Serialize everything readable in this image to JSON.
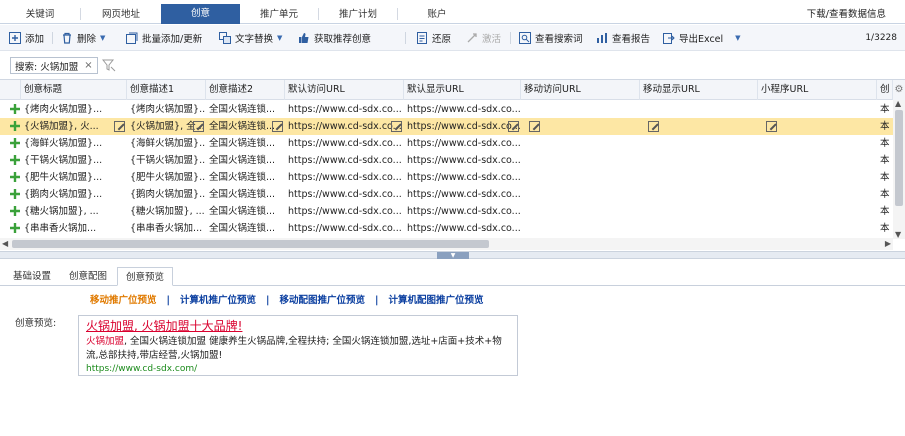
{
  "top_tabs": [
    "关键词",
    "网页地址",
    "创意",
    "推广单元",
    "推广计划",
    "账户"
  ],
  "top_right": "下载/查看数据信息",
  "toolbar": {
    "add": "添加",
    "delete": "删除",
    "batch": "批量添加/更新",
    "replace": "文字替换",
    "recommend": "获取推荐创意",
    "restore": "还原",
    "activate": "激活",
    "search_terms": "查看搜索词",
    "report": "查看报告",
    "export": "导出Excel",
    "counter": "1/3228"
  },
  "search": {
    "label": "搜索: 火锅加盟",
    "close": "×"
  },
  "grid": {
    "columns": [
      "创意标题",
      "创意描述1",
      "创意描述2",
      "默认访问URL",
      "默认显示URL",
      "移动访问URL",
      "移动显示URL",
      "小程序URL",
      "创"
    ],
    "rows": [
      [
        "{烤肉火锅加盟}...",
        "{烤肉火锅加盟}...",
        "全国火锅连锁...",
        "https://www.cd-sdx.co...",
        "https://www.cd-sdx.co...",
        "",
        "",
        "",
        "本"
      ],
      [
        "{火锅加盟}, 火...",
        "{火锅加盟}, 全...",
        "全国火锅连锁...",
        "https://www.cd-sdx.co...",
        "https://www.cd-sdx.co...",
        "",
        "",
        "",
        "本"
      ],
      [
        "{海鲜火锅加盟}...",
        "{海鲜火锅加盟}...",
        "全国火锅连锁...",
        "https://www.cd-sdx.co...",
        "https://www.cd-sdx.co...",
        "",
        "",
        "",
        "本"
      ],
      [
        "{干锅火锅加盟}...",
        "{干锅火锅加盟}...",
        "全国火锅连锁...",
        "https://www.cd-sdx.co...",
        "https://www.cd-sdx.co...",
        "",
        "",
        "",
        "本"
      ],
      [
        "{肥牛火锅加盟}...",
        "{肥牛火锅加盟}...",
        "全国火锅连锁...",
        "https://www.cd-sdx.co...",
        "https://www.cd-sdx.co...",
        "",
        "",
        "",
        "本"
      ],
      [
        "{鹅肉火锅加盟}...",
        "{鹅肉火锅加盟}...",
        "全国火锅连锁...",
        "https://www.cd-sdx.co...",
        "https://www.cd-sdx.co...",
        "",
        "",
        "",
        "本"
      ],
      [
        "{糖火锅加盟}, ...",
        "{糖火锅加盟}, ...",
        "全国火锅连锁...",
        "https://www.cd-sdx.co...",
        "https://www.cd-sdx.co...",
        "",
        "",
        "",
        "本"
      ],
      [
        "{串串香火锅加...",
        "{串串香火锅加...",
        "全国火锅连锁...",
        "https://www.cd-sdx.co...",
        "https://www.cd-sdx.co...",
        "",
        "",
        "",
        "本"
      ]
    ]
  },
  "bottom_tabs": [
    "基础设置",
    "创意配图",
    "创意预览"
  ],
  "preview": {
    "links": [
      "移动推广位预览",
      "计算机推广位预览",
      "移动配图推广位预览",
      "计算机配图推广位预览"
    ],
    "link_sep": "|",
    "label": "创意预览:",
    "title": "火锅加盟, 火锅加盟十大品牌!",
    "desc_highlight": "火锅加盟",
    "desc_rest": ", 全国火锅连锁加盟  健康养生火锅品牌,全程扶持; 全国火锅连锁加盟,选址+店面+技术+物流,总部扶持,带店经营,火锅加盟!",
    "url": "https://www.cd-sdx.com/"
  },
  "colors": {
    "accent": "#2f5fa1",
    "selected_row": "#fde7a4",
    "preview_red": "#d9002e",
    "preview_green": "#1a8a1a"
  }
}
